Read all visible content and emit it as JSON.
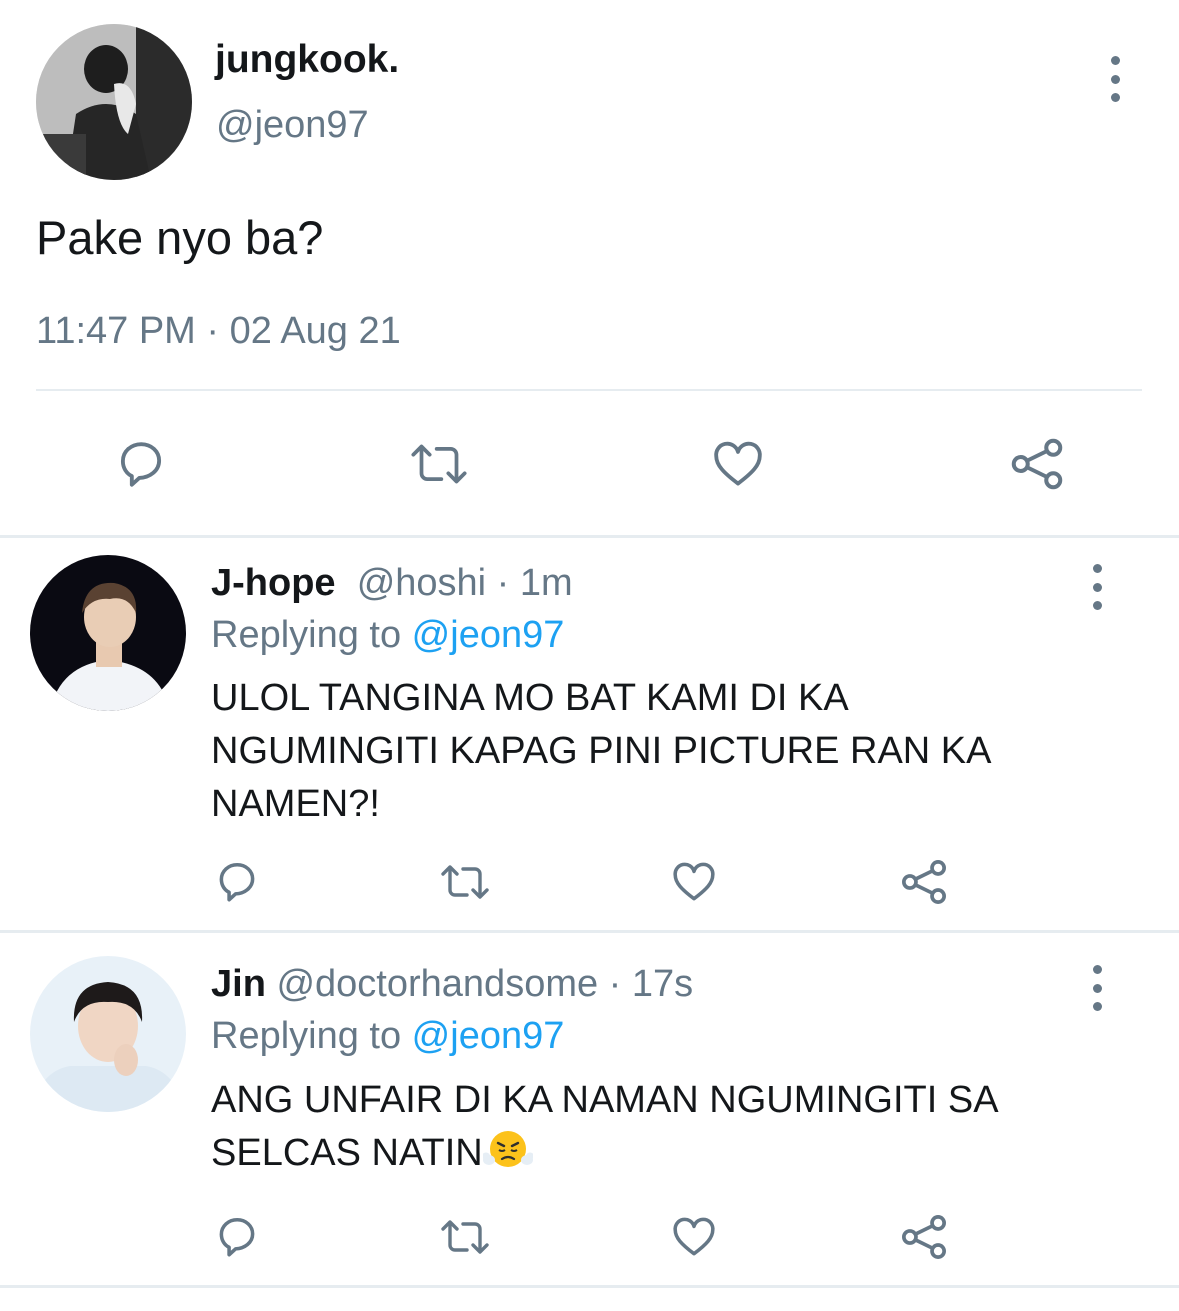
{
  "main_tweet": {
    "author_name": "jungkook.",
    "author_handle": "@jeon97",
    "text": "Pake nyo ba?",
    "timestamp": "11:47 PM · 02 Aug 21",
    "actions": [
      "reply-icon",
      "retweet-icon",
      "like-icon",
      "share-icon"
    ]
  },
  "replies": [
    {
      "author_name": "J-hope",
      "author_handle": "@hoshi",
      "time": " · 1m",
      "replying_prefix": "Replying to ",
      "replying_to": "@jeon97",
      "text_lines": [
        "ULOL TANGINA MO BAT KAMI DI KA",
        "NGUMINGITI KAPAG PINI PICTURE RAN KA",
        "NAMEN?!"
      ]
    },
    {
      "author_name": "Jin",
      "author_handle": "@doctorhandsome",
      "time": " · 17s",
      "replying_prefix": "Replying to ",
      "replying_to": "@jeon97",
      "text_lines": [
        "ANG UNFAIR DI KA NAMAN NGUMINGITI SA",
        "SELCAS NATIN"
      ],
      "emoji": "triumph-face-emoji"
    }
  ],
  "colors": {
    "text_primary": "#14171a",
    "text_secondary": "#657786",
    "link": "#1da1f2",
    "divider": "#e6ecf0"
  }
}
